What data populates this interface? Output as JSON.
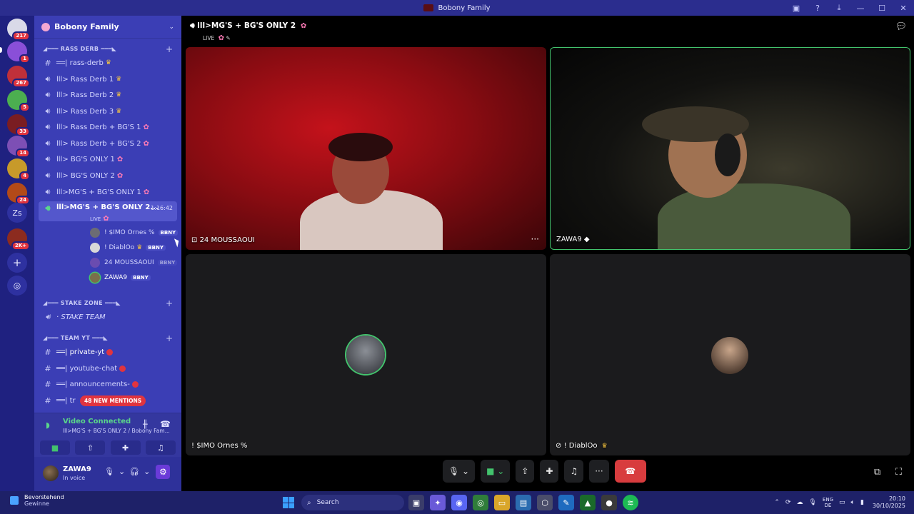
{
  "window": {
    "title": "Bobony Family",
    "controls": [
      "inbox-icon",
      "help-icon",
      "download-icon",
      "minimize-icon",
      "maximize-icon",
      "close-icon"
    ]
  },
  "servers": [
    {
      "badge": "217",
      "color": "#d9d9e8"
    },
    {
      "badge": "1",
      "color": "#8a4fd8"
    },
    {
      "badge": "267",
      "color": "#c0303a"
    },
    {
      "badge": "5",
      "color": "#4caf50"
    },
    {
      "badge": "33",
      "color": "#7a1d22"
    },
    {
      "badge": "14",
      "color": "#7d4fb5"
    },
    {
      "badge": "4",
      "color": "#c79a2a"
    },
    {
      "badge": "24",
      "color": "#b34a18"
    },
    {
      "badge": "",
      "label": "Zs",
      "color": "#2e31a0"
    },
    {
      "badge": "2K+",
      "color": "#8c2b1f"
    }
  ],
  "guild": {
    "name": "Bobony Family"
  },
  "categories": {
    "rass": "◢━━━ RASS DERB ━━━◣",
    "stake": "◢━━━ STAKE ZONE ━━━◣",
    "team": "◢━━━ TEAM YT ━━━◣"
  },
  "channels": {
    "rass_derb_text": "══| rass-derb",
    "rass_derb_1": "lll> Rass Derb 1",
    "rass_derb_2": "lll> Rass Derb 2",
    "rass_derb_3": "lll> Rass Derb 3",
    "rass_bg_1": "lll> Rass Derb + BG'S 1",
    "rass_bg_2": "lll> Rass Derb + BG'S 2",
    "bg_only_1": "lll> BG'S ONLY 1",
    "bg_only_2": "lll> BG'S ONLY 2",
    "mg_bg_1": "lll>MG'S + BG'S ONLY 1",
    "mg_bg_2": "lll>MG'S + BG'S ONLY 2...",
    "mg_bg_2_time": "1:16:42",
    "live": "LIVE",
    "stake_team": "· STAKE TEAM",
    "private_yt": "══| private-yt",
    "youtube_chat": "══| youtube-chat",
    "announcements": "══| announcements-",
    "trailing": "══| tr"
  },
  "voice_users": [
    {
      "name": "! $IMO Ornes %",
      "tag": "BBNY",
      "color": "#6c6c74"
    },
    {
      "name": "! DiablOo",
      "tag": "BBNY",
      "color": "#d8d8d8"
    },
    {
      "name": "24 MOUSSAOUI",
      "tag": "BBNY",
      "color": "#6a4cb0"
    },
    {
      "name": "ZAWA9",
      "tag": "BBNY",
      "color": "#7a6f4a"
    }
  ],
  "mentions": "48 NEW MENTIONS",
  "voice_panel": {
    "title": "Video Connected",
    "subtitle": "lll>MG'S + BG'S ONLY 2 / Bobony Fam..."
  },
  "user_panel": {
    "name": "ZAWA9",
    "status": "In voice"
  },
  "stage": {
    "channel": "lll>MG'S + BG'S ONLY 2",
    "live": "LIVE",
    "tiles": [
      {
        "label": "24 MOUSSAOUI"
      },
      {
        "label": "ZAWA9"
      },
      {
        "label": "! $IMO Ornes %"
      },
      {
        "label": "! DiablOo"
      }
    ]
  },
  "taskbar": {
    "weather_title": "Bevorstehend",
    "weather_sub": "Gewinne",
    "search_placeholder": "Search",
    "lang_top": "ENG",
    "lang_bottom": "DE",
    "time": "20:10",
    "date": "30/10/2025"
  }
}
